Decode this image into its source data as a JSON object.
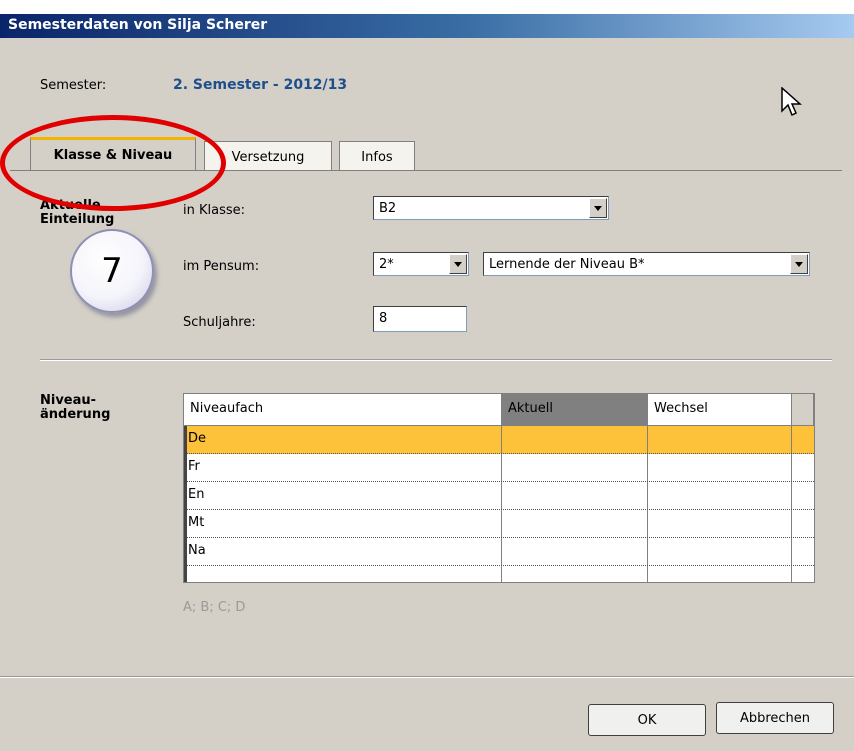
{
  "window": {
    "title": "Semesterdaten von Silja Scherer"
  },
  "semester": {
    "label": "Semester:",
    "value": "2. Semester - 2012/13"
  },
  "tabs": [
    {
      "label": "Klasse & Niveau",
      "active": true
    },
    {
      "label": "Versetzung",
      "active": false
    },
    {
      "label": "Infos",
      "active": false
    }
  ],
  "section1": {
    "title_line1": "Aktuelle",
    "title_line2": "Einteilung",
    "klasse_label": "in Klasse:",
    "klasse_value": "B2",
    "pensum_label": "im Pensum:",
    "pensum_value": "2*",
    "pensum_desc": "Lernende der Niveau B*",
    "schuljahre_label": "Schuljahre:",
    "schuljahre_value": "8"
  },
  "section2": {
    "title_line1": "Niveau-",
    "title_line2": "änderung",
    "columns": [
      "Niveaufach",
      "Aktuell",
      "Wechsel"
    ],
    "rows": [
      {
        "fach": "De",
        "aktuell": "",
        "wechsel": ""
      },
      {
        "fach": "Fr",
        "aktuell": "",
        "wechsel": ""
      },
      {
        "fach": "En",
        "aktuell": "",
        "wechsel": ""
      },
      {
        "fach": "Mt",
        "aktuell": "",
        "wechsel": ""
      },
      {
        "fach": "Na",
        "aktuell": "",
        "wechsel": ""
      }
    ],
    "hint": "A; B; C; D"
  },
  "buttons": {
    "ok": "OK",
    "cancel": "Abbrechen"
  },
  "annotation": {
    "step_number": "7"
  },
  "colors": {
    "selected_row": "#fdc13a",
    "annotation_ring": "#e00000",
    "accent_tab": "#f2b400"
  }
}
